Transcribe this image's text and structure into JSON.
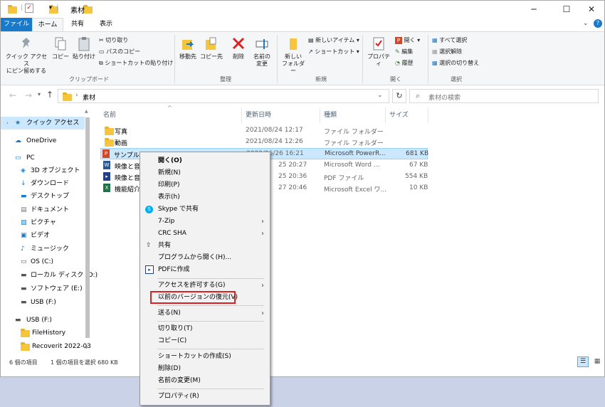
{
  "window": {
    "title": "素材"
  },
  "menu": {
    "tabs": [
      {
        "label": "ファイル"
      },
      {
        "label": "ホーム"
      },
      {
        "label": "共有"
      },
      {
        "label": "表示"
      }
    ]
  },
  "ribbon": {
    "clipboard": {
      "pin_label": "クイック アクセス\nにピン留めする",
      "copy_label": "コピー",
      "paste_label": "貼り付け",
      "cut_label": "切り取り",
      "copy_path_label": "パスのコピー",
      "paste_shortcut_label": "ショートカットの貼り付け",
      "group_label": "クリップボード"
    },
    "organize": {
      "move_label": "移動先",
      "copy_to_label": "コピー先",
      "delete_label": "削除",
      "rename_label": "名前の\n変更",
      "group_label": "整理"
    },
    "new": {
      "new_folder_label": "新しい\nフォルダー",
      "new_item_label": "新しいアイテム",
      "shortcut_label": "ショートカット",
      "group_label": "新規"
    },
    "open": {
      "properties_label": "プロパティ",
      "open_label": "開く",
      "edit_label": "編集",
      "history_label": "履歴",
      "group_label": "開く"
    },
    "select": {
      "select_all_label": "すべて選択",
      "select_none_label": "選択解除",
      "invert_label": "選択の切り替え",
      "group_label": "選択"
    }
  },
  "address": {
    "path": "素材",
    "search_placeholder": "素材の検索"
  },
  "nav": {
    "items": [
      {
        "label": "クイック アクセス"
      },
      {
        "label": "OneDrive"
      },
      {
        "label": "PC"
      },
      {
        "label": "3D オブジェクト"
      },
      {
        "label": "ダウンロード"
      },
      {
        "label": "デスクトップ"
      },
      {
        "label": "ドキュメント"
      },
      {
        "label": "ピクチャ"
      },
      {
        "label": "ビデオ"
      },
      {
        "label": "ミュージック"
      },
      {
        "label": "OS (C:)"
      },
      {
        "label": "ローカル ディスク (D:)"
      },
      {
        "label": "ソフトウェア (E:)"
      },
      {
        "label": "USB (F:)"
      },
      {
        "label": "USB (F:)"
      },
      {
        "label": "FileHistory"
      },
      {
        "label": "Recoverit 2022-03"
      }
    ]
  },
  "columns": {
    "name": "名前",
    "date": "更新日時",
    "type": "種類",
    "size": "サイズ"
  },
  "files": [
    {
      "name": "写真",
      "date": "2021/08/24 12:17",
      "type": "ファイル フォルダー",
      "size": ""
    },
    {
      "name": "動画",
      "date": "2021/08/24 12:26",
      "type": "ファイル フォルダー",
      "size": ""
    },
    {
      "name": "サンプル.p",
      "date": "2022/06/26 16:21",
      "type": "Microsoft PowerR...",
      "size": "681 KB"
    },
    {
      "name": "映像と音",
      "date": "25 20:27",
      "type": "Microsoft Word ...",
      "size": "67 KB"
    },
    {
      "name": "映像と音",
      "date": "25 20:36",
      "type": "PDF ファイル",
      "size": "554 KB"
    },
    {
      "name": "機能紹介",
      "date": "27 20:46",
      "type": "Microsoft Excel ワ...",
      "size": "10 KB"
    }
  ],
  "status": {
    "count": "6 個の項目",
    "selected": "1 個の項目を選択  680 KB"
  },
  "context_menu": {
    "open": "開く(O)",
    "new": "新規(N)",
    "print": "印刷(P)",
    "show": "表示(h)",
    "skype": "Skype で共有",
    "zip": "7-Zip",
    "crc": "CRC SHA",
    "share": "共有",
    "open_with": "プログラムから開く(H)...",
    "pdf": "PDFに作成",
    "give_access": "アクセスを許可する(G)",
    "restore": "以前のバージョンの復元(V)",
    "send_to": "送る(N)",
    "cut": "切り取り(T)",
    "copy": "コピー(C)",
    "create_shortcut": "ショートカットの作成(S)",
    "delete": "削除(D)",
    "rename": "名前の変更(M)",
    "properties": "プロパティ(R)"
  },
  "colors": {
    "accent": "#1979ca",
    "selection": "#cce8ff",
    "highlight": "#e02020"
  }
}
